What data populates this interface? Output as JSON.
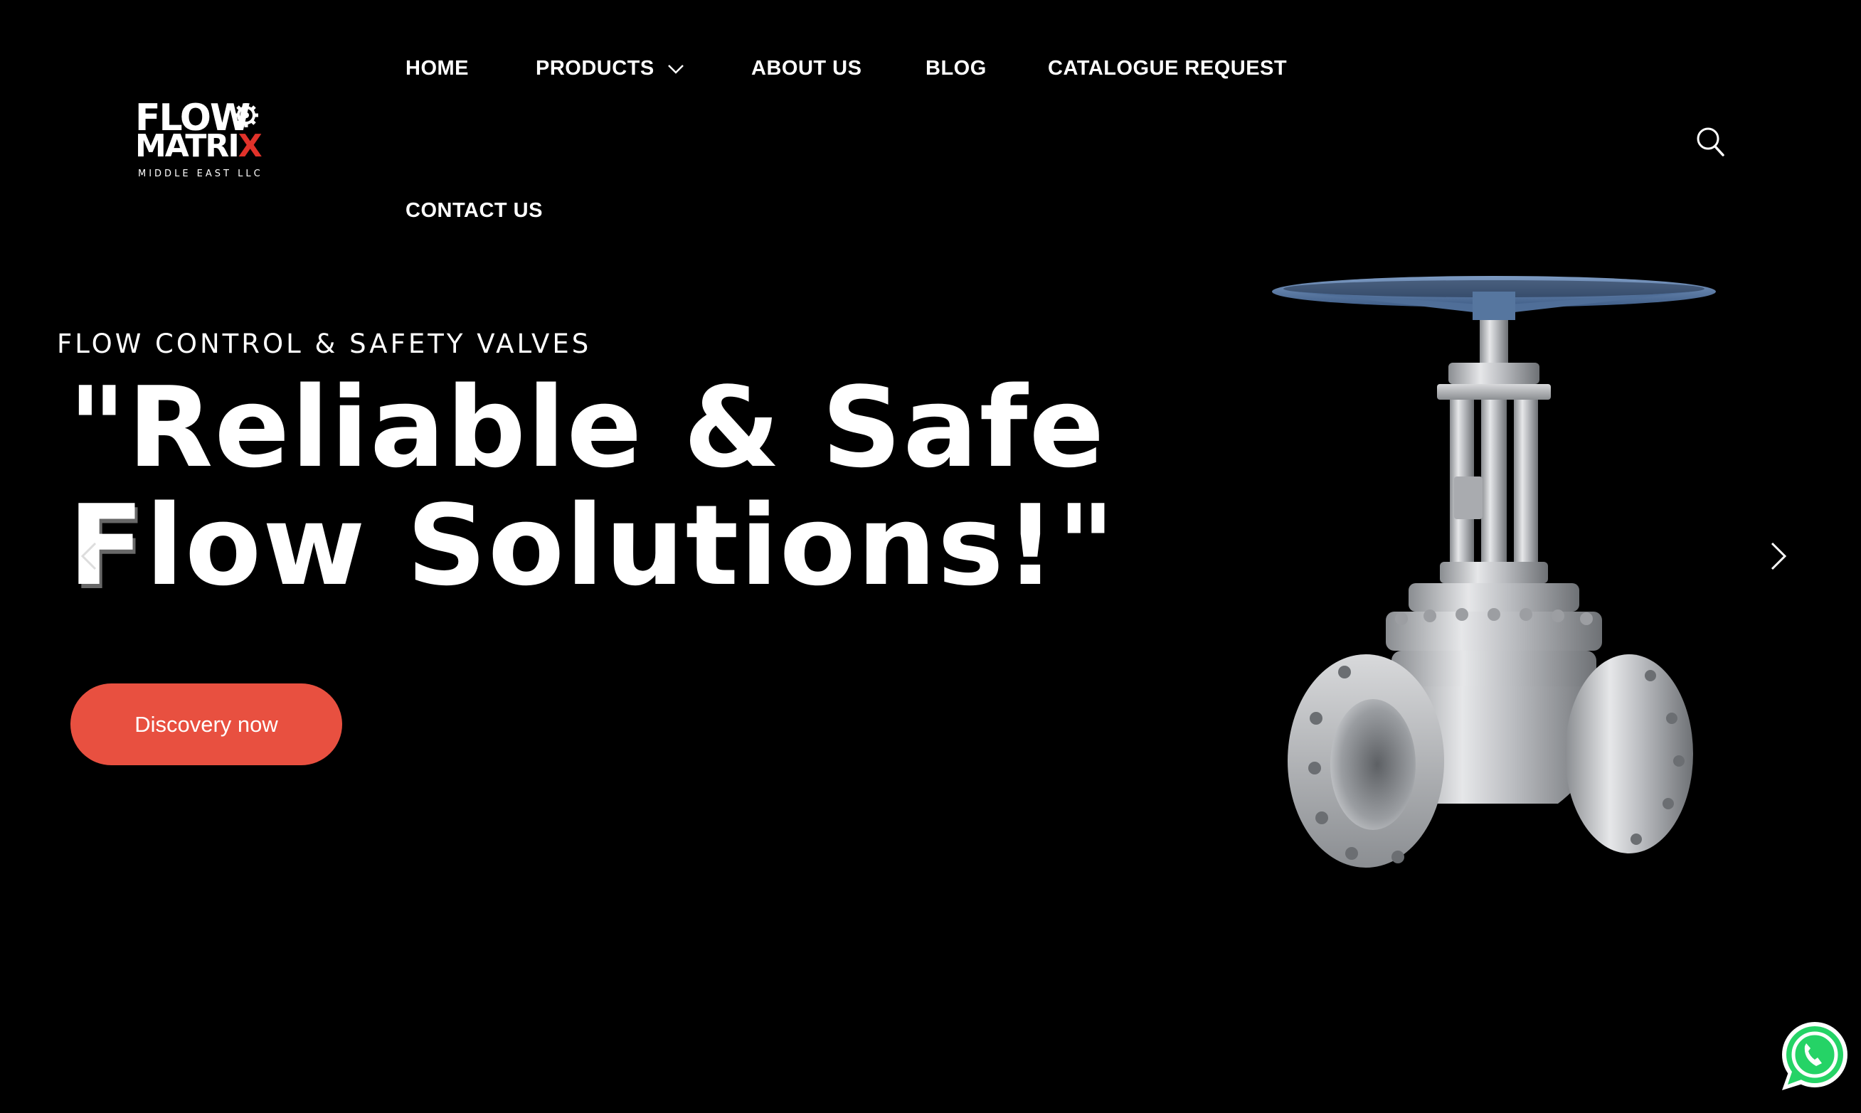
{
  "brand": {
    "logo_line1": "FLOW",
    "logo_line2_main": "MATRI",
    "logo_line2_accent": "X",
    "logo_subtitle": "MIDDLE EAST LLC",
    "accent_color": "#e1322a"
  },
  "nav": {
    "items": [
      {
        "label": "HOME"
      },
      {
        "label": "PRODUCTS",
        "has_dropdown": true
      },
      {
        "label": "ABOUT US"
      },
      {
        "label": "BLOG"
      },
      {
        "label": "CATALOGUE REQUEST"
      },
      {
        "label": "CONTACT US"
      }
    ],
    "search_icon": "search-icon"
  },
  "hero": {
    "eyebrow": "FLOW CONTROL & SAFETY VALVES",
    "headline_line1": "\"Reliable & Safe",
    "headline_line2": "Flow Solutions!\"",
    "ghost_letter": "F",
    "cta_label": "Discovery now",
    "cta_color": "#e85040",
    "prev_icon": "chevron-left-icon",
    "next_icon": "chevron-right-icon"
  },
  "floating": {
    "whatsapp_icon": "whatsapp-icon",
    "whatsapp_color": "#25d366"
  }
}
